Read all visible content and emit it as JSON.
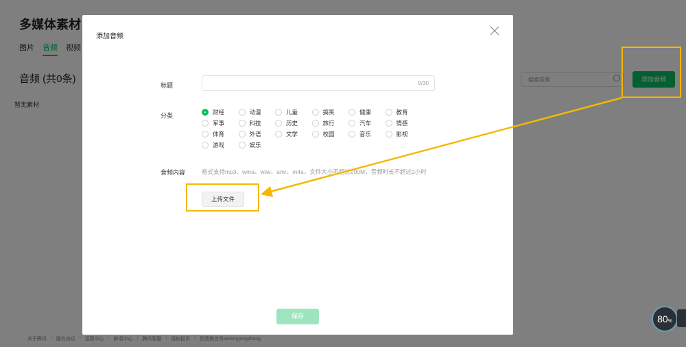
{
  "page": {
    "title": "多媒体素材",
    "tabs": [
      {
        "label": "图片"
      },
      {
        "label": "音频"
      },
      {
        "label": "视频"
      }
    ],
    "section_title": "音频  (共0条)",
    "empty_text": "暂无素材",
    "search_placeholder": "搜索音频",
    "add_button": "添加音频",
    "footer": [
      "关于腾讯",
      "服务协议",
      "运营中心",
      "辟谣中心",
      "腾讯客服",
      "侵权投诉",
      "反馈微信号weixingongzhong"
    ]
  },
  "modal": {
    "title": "添加音频",
    "title_label": "标题",
    "title_value": "",
    "title_counter": "0/30",
    "category_label": "分类",
    "categories": [
      [
        "财经",
        "动漫",
        "儿童",
        "搞笑",
        "健康",
        "教育"
      ],
      [
        "军事",
        "科技",
        "历史",
        "旅行",
        "汽车",
        "情感"
      ],
      [
        "体育",
        "外语",
        "文学",
        "校园",
        "音乐",
        "影视"
      ],
      [
        "游戏",
        "娱乐"
      ]
    ],
    "selected_category": "财经",
    "content_label": "音频内容",
    "format_hint": "格式支持mp3、wma、wav、amr、m4a，文件大小不超过200M，音频时长不超过2小时",
    "upload_button": "上传文件",
    "save_button": "保存"
  },
  "speed_widget": {
    "value": "80",
    "unit": "%"
  },
  "colors": {
    "accent": "#07c160",
    "highlight": "#f5b800",
    "overlay": "rgba(0,0,0,0.5)"
  }
}
